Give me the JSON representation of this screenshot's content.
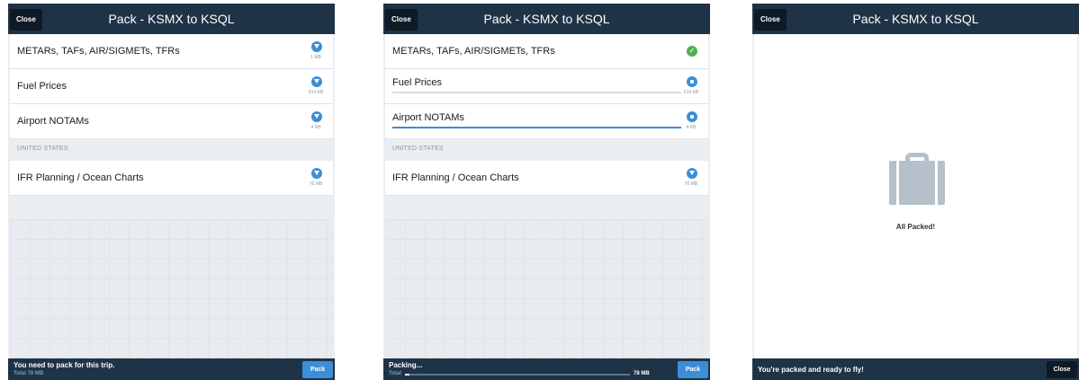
{
  "panel1": {
    "close_label": "Close",
    "title": "Pack - KSMX to KSQL",
    "rows": [
      {
        "label": "METARs, TAFs, AIR/SIGMETs, TFRs",
        "size": "1 MB"
      },
      {
        "label": "Fuel Prices",
        "size": "614 KB"
      },
      {
        "label": "Airport NOTAMs",
        "size": "4 KB"
      }
    ],
    "section_label": "UNITED STATES",
    "section_row": {
      "label": "IFR Planning / Ocean Charts",
      "size": "76 MB"
    },
    "status": "You need to pack for this trip.",
    "total_label": "Total",
    "total_value": "78 MB",
    "pack_label": "Pack"
  },
  "panel2": {
    "close_label": "Close",
    "title": "Pack - KSMX to KSQL",
    "rows": [
      {
        "label": "METARs, TAFs, AIR/SIGMETs, TFRs",
        "state": "done"
      },
      {
        "label": "Fuel Prices",
        "size": "614 KB",
        "progress": 0
      },
      {
        "label": "Airport NOTAMs",
        "size": "4 KB",
        "progress": 1.0
      }
    ],
    "section_label": "UNITED STATES",
    "section_row": {
      "label": "IFR Planning / Ocean Charts",
      "size": "76 MB"
    },
    "status": "Packing...",
    "total_label": "Total",
    "total_value": "78 MB",
    "total_progress": 0.02,
    "pack_label": "Pack"
  },
  "panel3": {
    "close_label": "Close",
    "title": "Pack - KSMX to KSQL",
    "message": "All Packed!",
    "status": "You're packed and ready to fly!",
    "close_bottom_label": "Close"
  },
  "colors": {
    "header": "#1f3347",
    "accent": "#3b8ed8",
    "success": "#4caf50",
    "background": "#ebeef1"
  },
  "icons": {
    "download": "download-icon",
    "pause": "pause-icon",
    "check": "check-icon",
    "suitcase": "suitcase-icon"
  }
}
